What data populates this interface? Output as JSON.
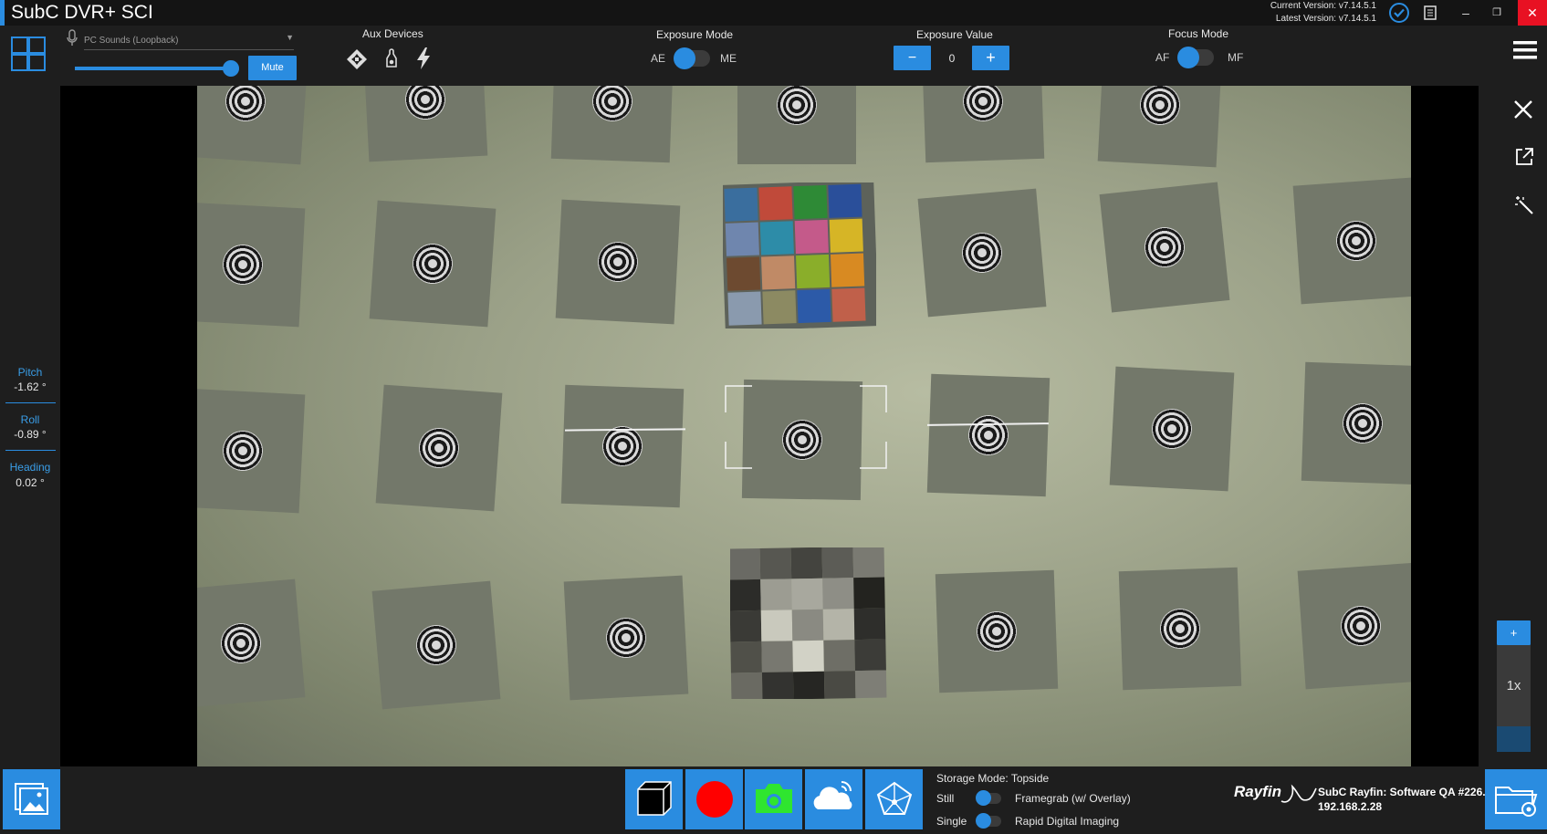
{
  "window": {
    "title": "SubC DVR+ SCI",
    "current_version": "Current Version: v7.14.5.1",
    "latest_version": "Latest Version: v7.14.5.1",
    "minimize": "–",
    "restore": "❐",
    "close": "✕"
  },
  "audio": {
    "source": "PC Sounds (Loopback)",
    "volume": 0.95,
    "mute_label": "Mute"
  },
  "aux_devices": {
    "label": "Aux Devices"
  },
  "exposure_mode": {
    "label": "Exposure Mode",
    "left": "AE",
    "right": "ME"
  },
  "exposure_value": {
    "label": "Exposure Value",
    "minus": "−",
    "value": "0",
    "plus": "+"
  },
  "focus_mode": {
    "label": "Focus Mode",
    "left": "AF",
    "right": "MF"
  },
  "telemetry": [
    {
      "label": "Pitch",
      "value": "-1.62 °"
    },
    {
      "label": "Roll",
      "value": "-0.89 °"
    },
    {
      "label": "Heading",
      "value": "0.02 °"
    }
  ],
  "zoom": {
    "plus": "+",
    "level": "1x"
  },
  "storage": {
    "mode": "Storage Mode: Topside",
    "row1_left": "Still",
    "row1_right": "Framegrab (w/ Overlay)",
    "row2_left": "Single",
    "row2_right": "Rapid Digital Imaging"
  },
  "device": {
    "brand": "Rayfin",
    "name": "SubC Rayfin: Software QA #226...",
    "ip": "192.168.2.28"
  },
  "colors": {
    "accent": "#2a8ce0",
    "record": "#ff0000",
    "camera": "#2fe52f"
  }
}
